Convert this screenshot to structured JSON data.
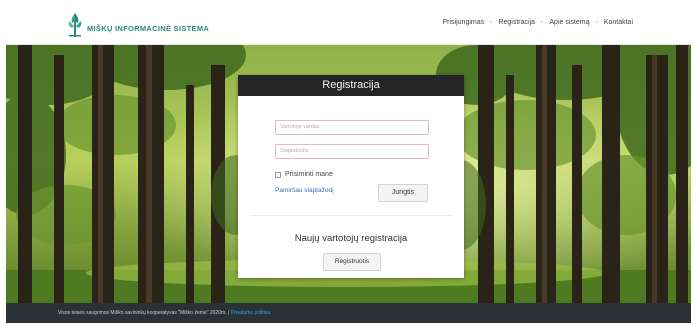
{
  "header": {
    "logo_text": "MIŠKŲ INFORMACINĖ SISTEMA",
    "nav": [
      {
        "label": "Prisijungimas"
      },
      {
        "label": "Registracija"
      },
      {
        "label": "Apie sistemą"
      },
      {
        "label": "Kontaktai"
      }
    ],
    "nav_separator": "-"
  },
  "card": {
    "title": "Registracija",
    "username_placeholder": "Vartotojo vardas",
    "password_placeholder": "Slaptažodis",
    "remember_label": "Prisiminti mane",
    "forgot_label": "Pamiršau slaptažodį",
    "login_button": "Jungtis",
    "register_heading": "Naujų vartotojų registracija",
    "register_button": "Registruotis"
  },
  "footer": {
    "text": "Visos teisės saugomos Miško savininkų kooperatyvas \"Miško žemė\" 2020m. |",
    "link_label": "Privatumo politika"
  },
  "colors": {
    "header_bg": "#ffffff",
    "card_title_bg": "#252525",
    "field_border": "#e2b9bd",
    "link": "#3b6fb5",
    "footer_bg": "#2b3236",
    "footer_link": "#3aa0e6",
    "logo": "#2a8a7a"
  },
  "icons": [
    "tree-logo-icon"
  ]
}
